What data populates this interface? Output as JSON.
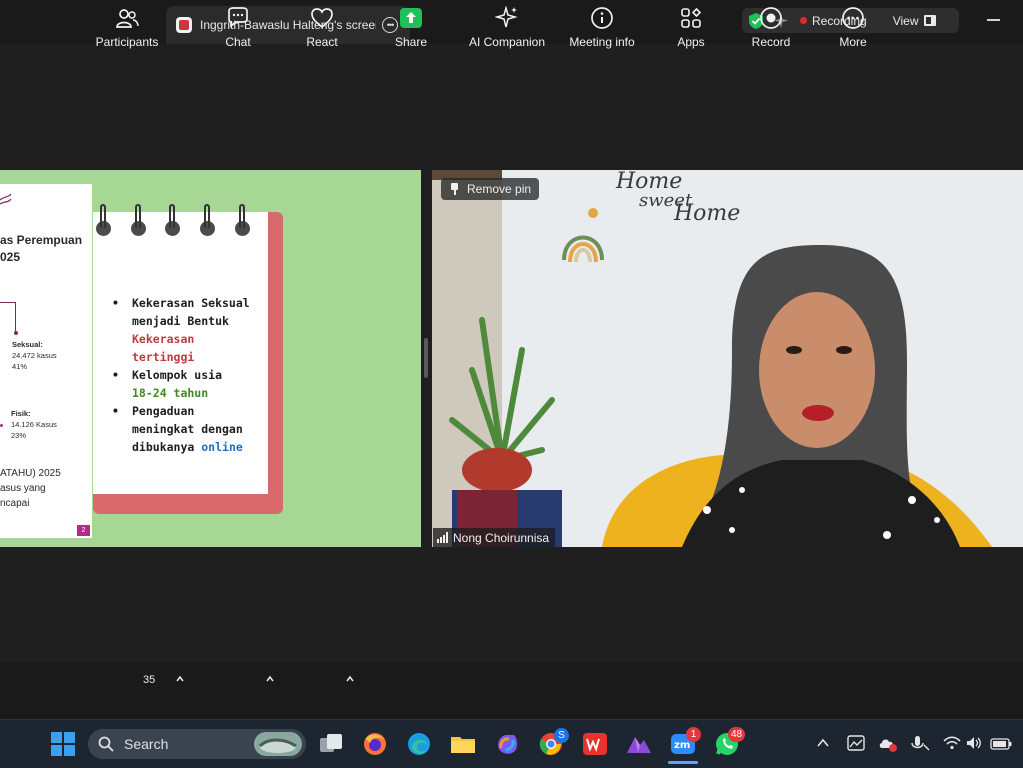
{
  "topbar": {
    "share_title": "Inggrith-Bawaslu Halteng's screen",
    "recording_label": "Recording",
    "view_label": "View"
  },
  "slide": {
    "side_title_1": "as Perempuan",
    "side_title_2": "025",
    "item1_label": "Seksual:",
    "item1_value": "24.472 kasus",
    "item1_pct": "41%",
    "item2_label": "Fisik:",
    "item2_value": "14.126 Kasus",
    "item2_pct": "23%",
    "foot_1": "ATAHU) 2025",
    "foot_2": "asus yang",
    "foot_3": "ncapai",
    "page_number": "2",
    "bullet1_line1": "Kekerasan Seksual",
    "bullet1_line2": "menjadi Bentuk",
    "bullet1_line3": "Kekerasan",
    "bullet1_line4": "tertinggi",
    "bullet2_line1": "Kelompok usia",
    "bullet2_line2": "18-24 tahun",
    "bullet3_line1": "Pengaduan",
    "bullet3_line2": "meningkat dengan",
    "bullet3_line3a": "dibukanya ",
    "bullet3_line3b": "online"
  },
  "video": {
    "remove_pin_label": "Remove pin",
    "participant_name": "Nong Choirunnisa",
    "wall_text_1": "Home",
    "wall_text_2": "sweet",
    "wall_text_3": "Home"
  },
  "toolbar": {
    "participants_label": "Participants",
    "participants_count": "35",
    "chat_label": "Chat",
    "react_label": "React",
    "share_label": "Share",
    "ai_label": "AI Companion",
    "meeting_info_label": "Meeting info",
    "apps_label": "Apps",
    "record_label": "Record",
    "more_label": "More"
  },
  "taskbar": {
    "search_placeholder": "Search",
    "zoom_badge": "1",
    "whatsapp_badge": "48",
    "chrome_badge": "S"
  },
  "colors": {
    "slide_bg": "#a6d795",
    "accent_red": "#c2393f",
    "accent_green": "#3f8a24",
    "accent_blue": "#1f6fc4",
    "share_green": "#1fbf5a",
    "recording_red": "#e02b2b"
  }
}
